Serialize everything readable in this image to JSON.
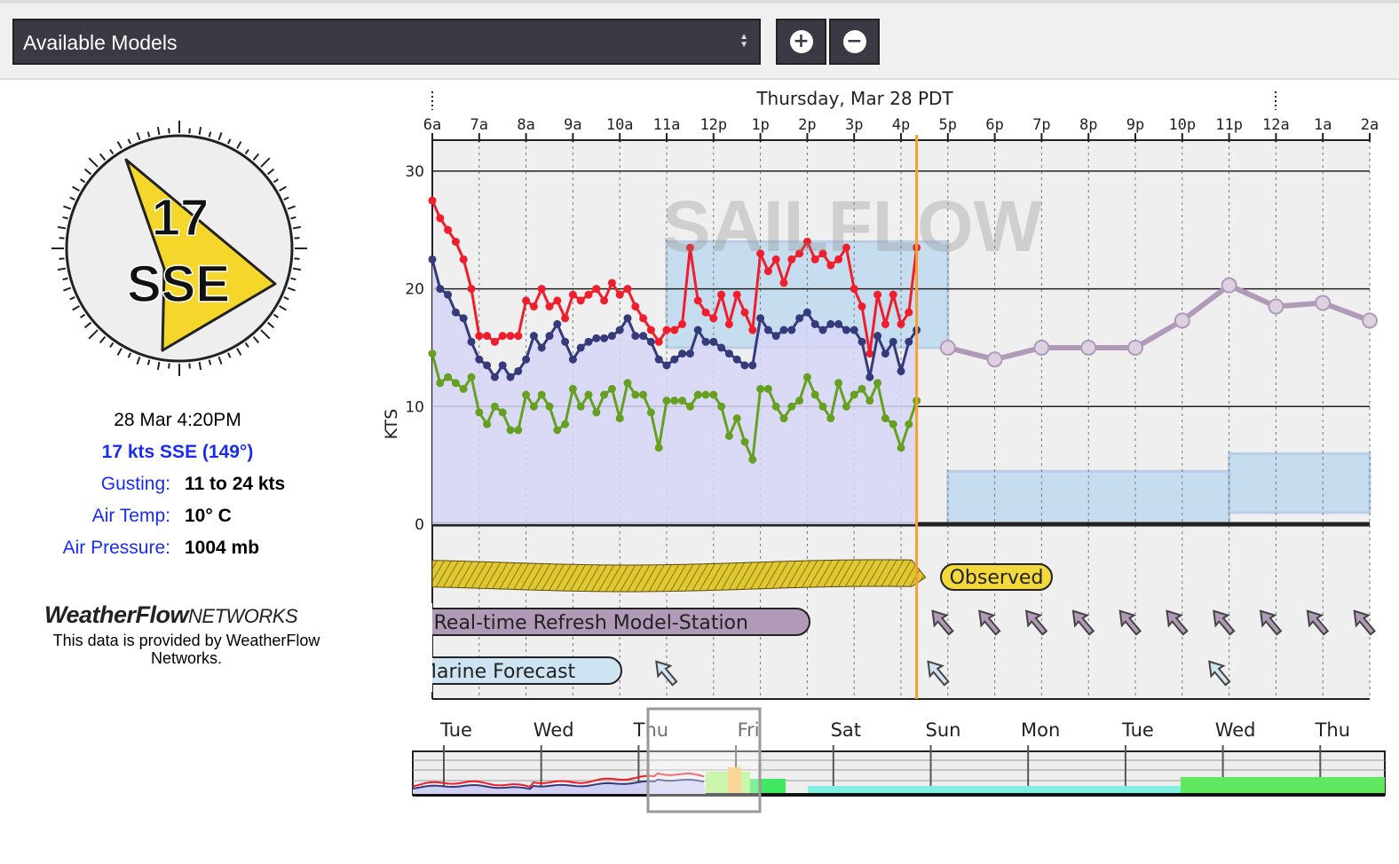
{
  "toolbar": {
    "models_select": "Available Models",
    "zoom_in": "+",
    "zoom_out": "−"
  },
  "station": {
    "compass_speed": "17",
    "compass_dir": "SSE",
    "timestamp": "28 Mar 4:20PM",
    "wind_summary": "17 kts SSE (149°)",
    "rows": [
      {
        "label": "Gusting:",
        "value": "11 to 24 kts"
      },
      {
        "label": "Air Temp:",
        "value": "10° C"
      },
      {
        "label": "Air Pressure:",
        "value": "1004 mb"
      }
    ],
    "logo": "WeatherFlowNETWORKS",
    "credit": "This data is provided by WeatherFlow Networks."
  },
  "chart_data": {
    "type": "line",
    "title": "Thursday, Mar 28 PDT",
    "ylabel": "KTS",
    "ylim": [
      0,
      30
    ],
    "yticks": [
      0,
      10,
      20,
      30
    ],
    "xticks": [
      "6a",
      "7a",
      "8a",
      "9a",
      "10a",
      "11a",
      "12p",
      "1p",
      "2p",
      "3p",
      "4p",
      "5p",
      "6p",
      "7p",
      "8p",
      "9p",
      "10p",
      "11p",
      "12a",
      "1a",
      "2a"
    ],
    "xrange": [
      "06:00",
      "02:00+1"
    ],
    "now": "16:20",
    "grid": true,
    "watermark": "SAILFLOW",
    "colors": {
      "gust": "#f01e2c",
      "mean": "#353a7a",
      "lull": "#66a020",
      "model": "#b09ab8",
      "marine": "#b8d8ee",
      "fill": "#d6d6f8",
      "now": "#f5a030",
      "observed": "#f2d83a"
    },
    "x": [
      "06:00",
      "06:10",
      "06:20",
      "06:30",
      "06:40",
      "06:50",
      "07:00",
      "07:10",
      "07:20",
      "07:30",
      "07:40",
      "07:50",
      "08:00",
      "08:10",
      "08:20",
      "08:30",
      "08:40",
      "08:50",
      "09:00",
      "09:10",
      "09:20",
      "09:30",
      "09:40",
      "09:50",
      "10:00",
      "10:10",
      "10:20",
      "10:30",
      "10:40",
      "10:50",
      "11:00",
      "11:10",
      "11:20",
      "11:30",
      "11:40",
      "11:50",
      "12:00",
      "12:10",
      "12:20",
      "12:30",
      "12:40",
      "12:50",
      "13:00",
      "13:10",
      "13:20",
      "13:30",
      "13:40",
      "13:50",
      "14:00",
      "14:10",
      "14:20",
      "14:30",
      "14:40",
      "14:50",
      "15:00",
      "15:10",
      "15:20",
      "15:30",
      "15:40",
      "15:50",
      "16:00",
      "16:10",
      "16:20"
    ],
    "series": [
      {
        "key": "gust",
        "values": [
          27.5,
          26,
          25,
          24,
          22.5,
          20,
          16,
          16,
          15.5,
          16,
          16,
          16,
          19,
          18.5,
          20,
          18.5,
          19,
          17.5,
          19.5,
          19,
          19.5,
          20,
          19,
          20.5,
          19.5,
          20,
          18.5,
          17.5,
          16.5,
          15.5,
          16.5,
          16.5,
          17,
          23.5,
          19,
          18,
          17.5,
          19.5,
          17,
          19.5,
          18,
          16.5,
          23,
          21.5,
          22.5,
          20.5,
          22.5,
          23,
          24,
          22.5,
          23,
          22,
          22.5,
          23.5,
          20,
          18.5,
          14.5,
          19.5,
          17,
          19.5,
          17,
          18,
          23.5
        ]
      },
      {
        "key": "mean",
        "values": [
          22.5,
          20,
          19.5,
          18,
          17.5,
          15.5,
          14,
          13.5,
          12.5,
          13.5,
          12.5,
          13,
          14,
          16,
          15,
          16,
          17,
          15.5,
          14,
          15,
          15.5,
          15.8,
          15.8,
          16,
          16.5,
          17.5,
          16,
          16,
          15.5,
          14,
          13.5,
          14,
          14.5,
          14.5,
          16.5,
          15.5,
          15.5,
          15,
          14.5,
          14,
          13.5,
          13.5,
          17.5,
          16.5,
          16,
          16.5,
          16.5,
          17.5,
          18,
          17,
          16.5,
          17,
          17,
          16.5,
          16.5,
          15.5,
          12.5,
          16,
          14.5,
          15.5,
          13,
          15.5,
          16.5
        ]
      },
      {
        "key": "lull",
        "values": [
          14.5,
          12,
          12.5,
          12,
          11.5,
          12.5,
          9.5,
          8.5,
          10,
          9.5,
          8,
          8,
          11,
          10,
          11,
          10,
          8,
          8.5,
          11.5,
          10,
          11,
          9.5,
          11,
          11.5,
          9,
          12,
          11,
          11,
          9.5,
          6.5,
          10.5,
          10.5,
          10.5,
          10,
          11,
          11,
          11,
          10,
          7.5,
          9,
          7,
          5.5,
          11.5,
          11.5,
          10,
          9,
          10,
          10.5,
          12.5,
          11,
          10,
          9,
          12,
          10,
          11,
          11.5,
          10.5,
          12,
          9,
          8.5,
          6.5,
          8.5,
          10.5
        ]
      }
    ],
    "model_forecast": {
      "name": "t Real-time Refresh Model-Station",
      "x": [
        "17:00",
        "18:00",
        "19:00",
        "20:00",
        "21:00",
        "22:00",
        "23:00",
        "00:00",
        "01:00",
        "02:00"
      ],
      "values": [
        15,
        14,
        15,
        15,
        15,
        17.3,
        20.3,
        18.5,
        18.8,
        17.3
      ]
    },
    "marine_forecast": {
      "name": "Marine Forecast",
      "bands": [
        {
          "from": "11:00",
          "to": "17:00",
          "low": 15,
          "high": 24
        },
        {
          "from": "17:00",
          "to": "23:00",
          "low": 0,
          "high": 4.5
        },
        {
          "from": "23:00",
          "to": "02:00",
          "low": 1,
          "high": 6
        }
      ]
    },
    "observed_label": "Observed",
    "overview": {
      "days": [
        "Tue",
        "Wed",
        "Thu",
        "Fri",
        "Sat",
        "Sun",
        "Mon",
        "Tue",
        "Wed",
        "Thu"
      ]
    }
  }
}
